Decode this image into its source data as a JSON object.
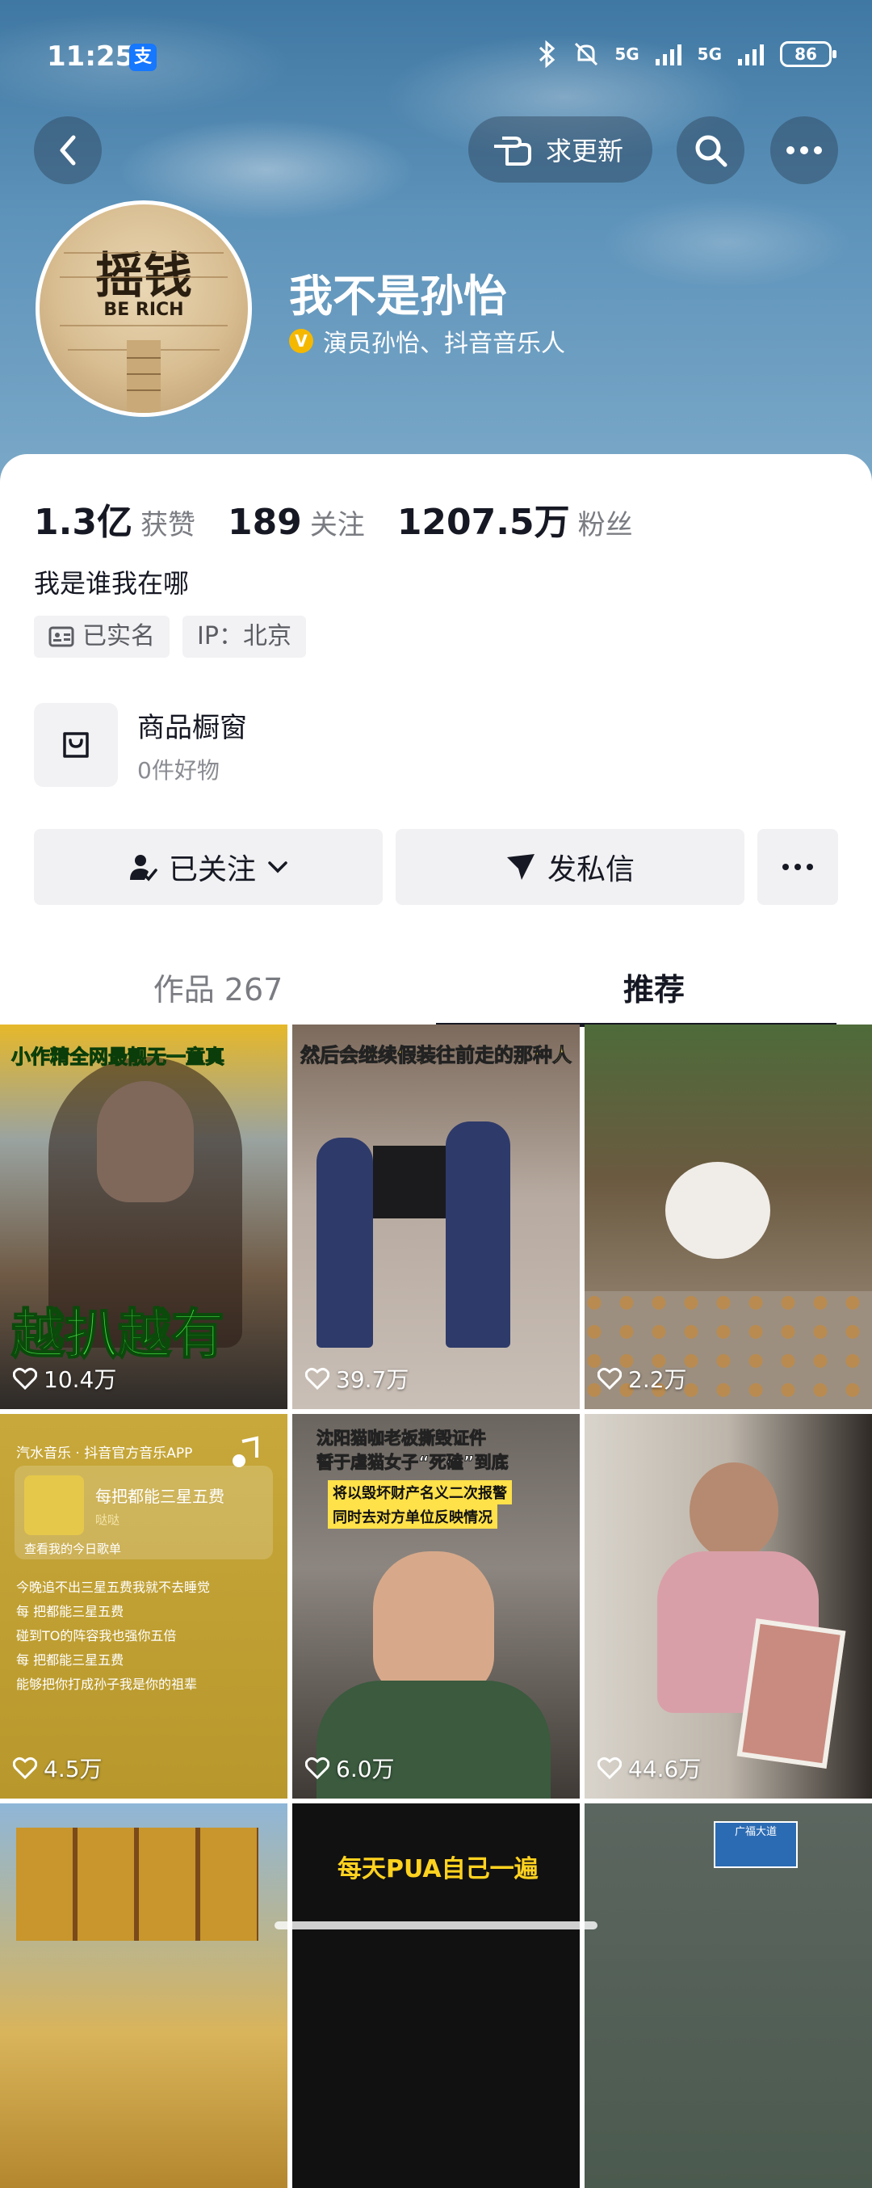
{
  "status_bar": {
    "time": "11:25",
    "alipay": "支",
    "net1": "5G",
    "net2": "5G",
    "battery": "86"
  },
  "header": {
    "request_update": "求更新",
    "avatar_text_top": "摇钱",
    "avatar_text_bottom": "BE    RICH",
    "name": "我不是孙怡",
    "cert_badge": "V",
    "cert": "演员孙怡、抖音音乐人"
  },
  "stats": [
    {
      "num": "1.3亿",
      "label": "获赞"
    },
    {
      "num": "189",
      "label": "关注"
    },
    {
      "num": "1207.5万",
      "label": "粉丝"
    }
  ],
  "bio": "我是谁我在哪",
  "tags": {
    "real_name": "已实名",
    "ip": "IP：北京"
  },
  "shop": {
    "title": "商品橱窗",
    "sub": "0件好物"
  },
  "actions": {
    "follow": "已关注",
    "message": "发私信"
  },
  "tabs": {
    "works": "作品 267",
    "recommend": "推荐"
  },
  "grid": [
    {
      "likes": "10.4万",
      "top_text": "小作精全网最靓无一童真",
      "bottom_text": "越扒越有"
    },
    {
      "likes": "39.7万",
      "top_text": "然后会继续假装往前走的那种人"
    },
    {
      "likes": "2.2万"
    },
    {
      "likes": "4.5万",
      "app": "汽水音乐 · 抖音官方音乐APP",
      "song": "每把都能三星五费",
      "artist": "哒哒",
      "daily": "查看我的今日歌单",
      "lyrics": [
        "今晚追不出三星五费我就不去睡觉",
        "每 把都能三星五费",
        "碰到TO的阵容我也强你五倍",
        "每 把都能三星五费",
        "能够把你打成孙子我是你的祖辈"
      ]
    },
    {
      "likes": "6.0万",
      "top_text1": "沈阳猫咖老板撕毁证件",
      "top_text2": "誓于虐猫女子“死磕”到底",
      "sub1": "将以毁坏财产名义二次报警",
      "sub2": "同时去对方单位反映情况"
    },
    {
      "likes": "44.6万"
    },
    {
      "likes": ""
    },
    {
      "likes": "",
      "top_text": "每天PUA自己一遍"
    },
    {
      "likes": "",
      "sign": "广福大道"
    }
  ]
}
